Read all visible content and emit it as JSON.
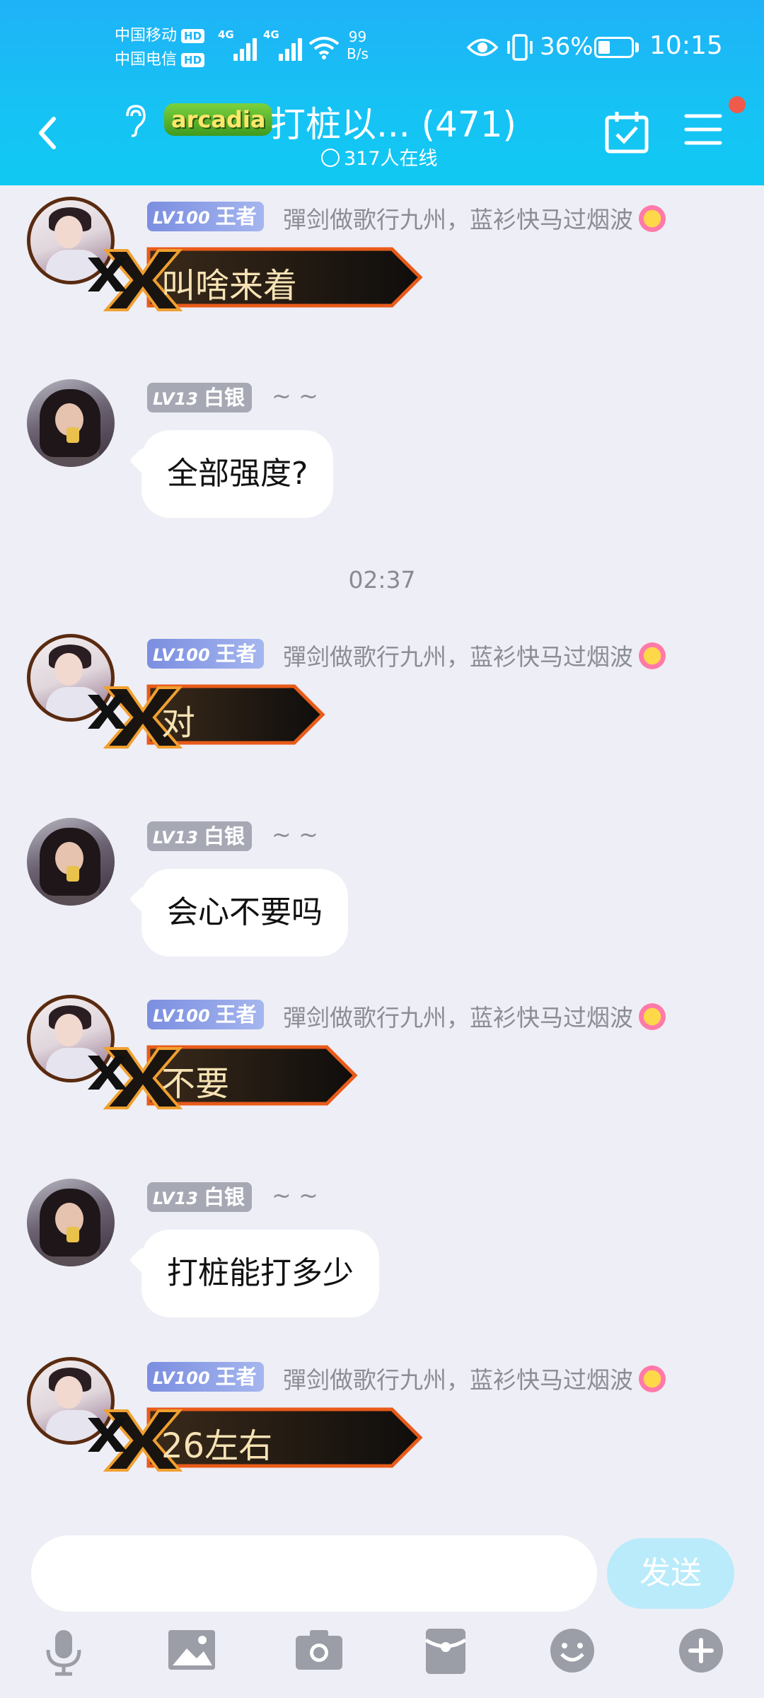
{
  "status_bar": {
    "carrier1": "中国移动",
    "carrier2": "中国电信",
    "hd": "HD",
    "net1": "4G",
    "net2": "4G",
    "speed_value": "99",
    "speed_unit": "B/s",
    "battery": "36%",
    "battery_level": 0.36,
    "time": "10:15"
  },
  "header": {
    "group_tag": "arcadia",
    "title": "打桩以... (471)",
    "online": "317人在线",
    "icons": [
      "back-icon",
      "ear-icon",
      "calendar-check-icon",
      "menu-icon"
    ]
  },
  "messages": [
    {
      "sender": "王者",
      "level": "LV100",
      "rank": "王者",
      "nick": "彈剑做歌行九州，蓝衫快马过烟波",
      "text": "叫啥来着",
      "style": "badge"
    },
    {
      "sender": "白银",
      "level": "LV13",
      "rank": "白银",
      "nick": "~ ~",
      "text": "全部强度?",
      "style": "bubble"
    },
    {
      "sender": "王者",
      "level": "LV100",
      "rank": "王者",
      "nick": "彈剑做歌行九州，蓝衫快马过烟波",
      "text": "对",
      "style": "badge"
    },
    {
      "sender": "白银",
      "level": "LV13",
      "rank": "白银",
      "nick": "~ ~",
      "text": "会心不要吗",
      "style": "bubble"
    },
    {
      "sender": "王者",
      "level": "LV100",
      "rank": "王者",
      "nick": "彈剑做歌行九州，蓝衫快马过烟波",
      "text": "不要",
      "style": "badge"
    },
    {
      "sender": "白银",
      "level": "LV13",
      "rank": "白银",
      "nick": "~ ~",
      "text": "打桩能打多少",
      "style": "bubble"
    },
    {
      "sender": "王者",
      "level": "LV100",
      "rank": "王者",
      "nick": "彈剑做歌行九州，蓝衫快马过烟波",
      "text": "26左右",
      "style": "badge"
    }
  ],
  "timestamp": "02:37",
  "input": {
    "placeholder": "",
    "send_label": "发送"
  },
  "toolbar": [
    "mic-icon",
    "image-icon",
    "camera-icon",
    "red-packet-icon",
    "emoji-icon",
    "plus-icon"
  ],
  "colors": {
    "header": "#16c3f4",
    "background": "#eeeef6",
    "send": "#b9ebfb"
  }
}
